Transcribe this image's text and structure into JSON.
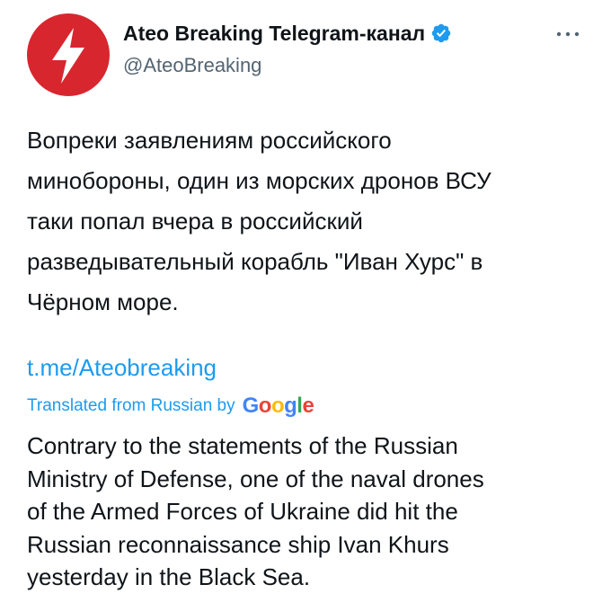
{
  "author": {
    "display_name": "Ateo Breaking Telegram-канал",
    "handle": "@AteoBreaking",
    "avatar_icon": "lightning-bolt-icon",
    "avatar_color": "#d8262f",
    "verified_icon": "verified-badge-icon",
    "verified_color": "#1d9bf0"
  },
  "menu": {
    "icon": "more-options-icon"
  },
  "tweet": {
    "lines": [
      "Вопреки заявлениям российского",
      "минобороны, один из морских дронов ВСУ",
      "таки попал вчера в российский",
      "разведывательный корабль \"Иван Хурс\" в",
      "Чёрном море."
    ],
    "link": "t.me/Ateobreaking"
  },
  "translation": {
    "label": "Translated from Russian by",
    "provider": {
      "letters": [
        "G",
        "o",
        "o",
        "g",
        "l",
        "e"
      ],
      "colors": [
        "#4285f4",
        "#ea4335",
        "#fbbc05",
        "#4285f4",
        "#34a853",
        "#ea4335"
      ]
    },
    "lines": [
      "Contrary to the statements of the Russian",
      "Ministry of Defense, one of the naval drones",
      "of the Armed Forces of Ukraine did hit the",
      "Russian reconnaissance ship Ivan Khurs",
      "yesterday in the Black Sea."
    ]
  },
  "colors": {
    "accent": "#1d9bf0",
    "text": "#0f1419",
    "secondary": "#536471"
  }
}
